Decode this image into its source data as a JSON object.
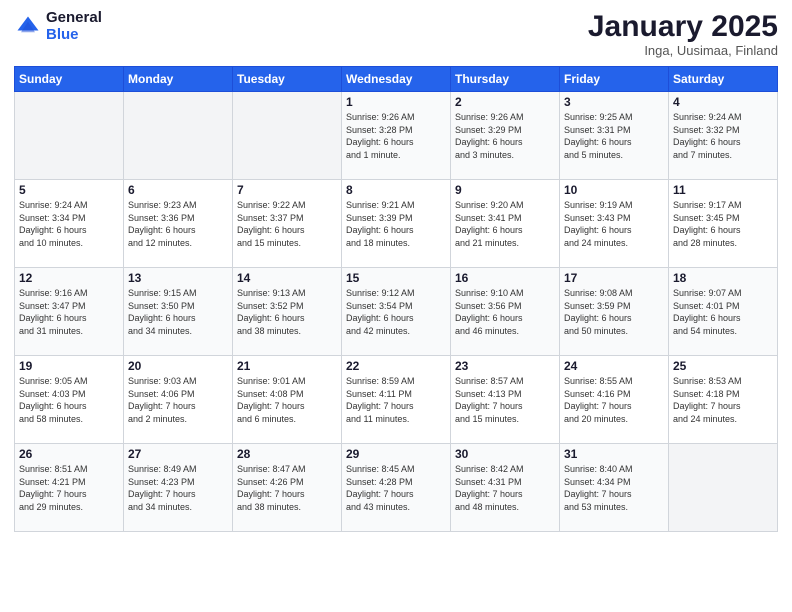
{
  "header": {
    "logo_general": "General",
    "logo_blue": "Blue",
    "month_title": "January 2025",
    "location": "Inga, Uusimaa, Finland"
  },
  "weekdays": [
    "Sunday",
    "Monday",
    "Tuesday",
    "Wednesday",
    "Thursday",
    "Friday",
    "Saturday"
  ],
  "weeks": [
    [
      {
        "day": "",
        "info": ""
      },
      {
        "day": "",
        "info": ""
      },
      {
        "day": "",
        "info": ""
      },
      {
        "day": "1",
        "info": "Sunrise: 9:26 AM\nSunset: 3:28 PM\nDaylight: 6 hours\nand 1 minute."
      },
      {
        "day": "2",
        "info": "Sunrise: 9:26 AM\nSunset: 3:29 PM\nDaylight: 6 hours\nand 3 minutes."
      },
      {
        "day": "3",
        "info": "Sunrise: 9:25 AM\nSunset: 3:31 PM\nDaylight: 6 hours\nand 5 minutes."
      },
      {
        "day": "4",
        "info": "Sunrise: 9:24 AM\nSunset: 3:32 PM\nDaylight: 6 hours\nand 7 minutes."
      }
    ],
    [
      {
        "day": "5",
        "info": "Sunrise: 9:24 AM\nSunset: 3:34 PM\nDaylight: 6 hours\nand 10 minutes."
      },
      {
        "day": "6",
        "info": "Sunrise: 9:23 AM\nSunset: 3:36 PM\nDaylight: 6 hours\nand 12 minutes."
      },
      {
        "day": "7",
        "info": "Sunrise: 9:22 AM\nSunset: 3:37 PM\nDaylight: 6 hours\nand 15 minutes."
      },
      {
        "day": "8",
        "info": "Sunrise: 9:21 AM\nSunset: 3:39 PM\nDaylight: 6 hours\nand 18 minutes."
      },
      {
        "day": "9",
        "info": "Sunrise: 9:20 AM\nSunset: 3:41 PM\nDaylight: 6 hours\nand 21 minutes."
      },
      {
        "day": "10",
        "info": "Sunrise: 9:19 AM\nSunset: 3:43 PM\nDaylight: 6 hours\nand 24 minutes."
      },
      {
        "day": "11",
        "info": "Sunrise: 9:17 AM\nSunset: 3:45 PM\nDaylight: 6 hours\nand 28 minutes."
      }
    ],
    [
      {
        "day": "12",
        "info": "Sunrise: 9:16 AM\nSunset: 3:47 PM\nDaylight: 6 hours\nand 31 minutes."
      },
      {
        "day": "13",
        "info": "Sunrise: 9:15 AM\nSunset: 3:50 PM\nDaylight: 6 hours\nand 34 minutes."
      },
      {
        "day": "14",
        "info": "Sunrise: 9:13 AM\nSunset: 3:52 PM\nDaylight: 6 hours\nand 38 minutes."
      },
      {
        "day": "15",
        "info": "Sunrise: 9:12 AM\nSunset: 3:54 PM\nDaylight: 6 hours\nand 42 minutes."
      },
      {
        "day": "16",
        "info": "Sunrise: 9:10 AM\nSunset: 3:56 PM\nDaylight: 6 hours\nand 46 minutes."
      },
      {
        "day": "17",
        "info": "Sunrise: 9:08 AM\nSunset: 3:59 PM\nDaylight: 6 hours\nand 50 minutes."
      },
      {
        "day": "18",
        "info": "Sunrise: 9:07 AM\nSunset: 4:01 PM\nDaylight: 6 hours\nand 54 minutes."
      }
    ],
    [
      {
        "day": "19",
        "info": "Sunrise: 9:05 AM\nSunset: 4:03 PM\nDaylight: 6 hours\nand 58 minutes."
      },
      {
        "day": "20",
        "info": "Sunrise: 9:03 AM\nSunset: 4:06 PM\nDaylight: 7 hours\nand 2 minutes."
      },
      {
        "day": "21",
        "info": "Sunrise: 9:01 AM\nSunset: 4:08 PM\nDaylight: 7 hours\nand 6 minutes."
      },
      {
        "day": "22",
        "info": "Sunrise: 8:59 AM\nSunset: 4:11 PM\nDaylight: 7 hours\nand 11 minutes."
      },
      {
        "day": "23",
        "info": "Sunrise: 8:57 AM\nSunset: 4:13 PM\nDaylight: 7 hours\nand 15 minutes."
      },
      {
        "day": "24",
        "info": "Sunrise: 8:55 AM\nSunset: 4:16 PM\nDaylight: 7 hours\nand 20 minutes."
      },
      {
        "day": "25",
        "info": "Sunrise: 8:53 AM\nSunset: 4:18 PM\nDaylight: 7 hours\nand 24 minutes."
      }
    ],
    [
      {
        "day": "26",
        "info": "Sunrise: 8:51 AM\nSunset: 4:21 PM\nDaylight: 7 hours\nand 29 minutes."
      },
      {
        "day": "27",
        "info": "Sunrise: 8:49 AM\nSunset: 4:23 PM\nDaylight: 7 hours\nand 34 minutes."
      },
      {
        "day": "28",
        "info": "Sunrise: 8:47 AM\nSunset: 4:26 PM\nDaylight: 7 hours\nand 38 minutes."
      },
      {
        "day": "29",
        "info": "Sunrise: 8:45 AM\nSunset: 4:28 PM\nDaylight: 7 hours\nand 43 minutes."
      },
      {
        "day": "30",
        "info": "Sunrise: 8:42 AM\nSunset: 4:31 PM\nDaylight: 7 hours\nand 48 minutes."
      },
      {
        "day": "31",
        "info": "Sunrise: 8:40 AM\nSunset: 4:34 PM\nDaylight: 7 hours\nand 53 minutes."
      },
      {
        "day": "",
        "info": ""
      }
    ]
  ]
}
